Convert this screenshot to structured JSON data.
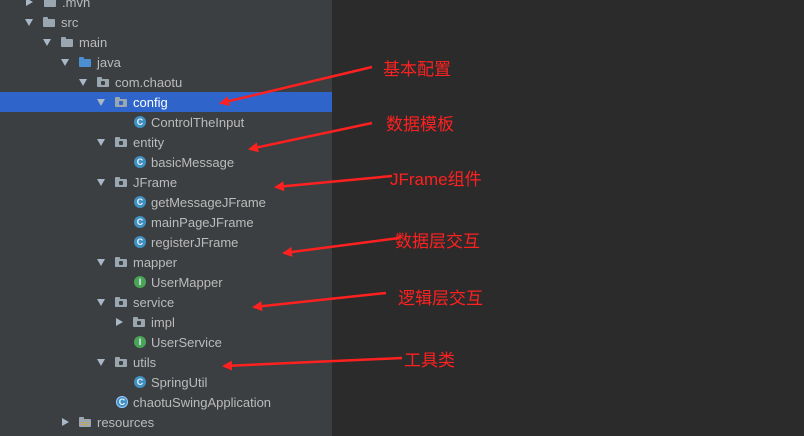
{
  "tree": {
    "rows": [
      {
        "label": ".mvn",
        "icon": "folder-icon"
      },
      {
        "label": "src",
        "icon": "folder-icon"
      },
      {
        "label": "main",
        "icon": "folder-icon"
      },
      {
        "label": "java",
        "icon": "source-folder-icon"
      },
      {
        "label": "com.chaotu",
        "icon": "package-icon"
      },
      {
        "label": "config",
        "icon": "package-icon",
        "selected": true
      },
      {
        "label": "ControlTheInput",
        "icon": "class-icon",
        "glyph": "C"
      },
      {
        "label": "entity",
        "icon": "package-icon"
      },
      {
        "label": "basicMessage",
        "icon": "class-icon",
        "glyph": "C"
      },
      {
        "label": "JFrame",
        "icon": "package-icon"
      },
      {
        "label": "getMessageJFrame",
        "icon": "class-icon",
        "glyph": "C"
      },
      {
        "label": "mainPageJFrame",
        "icon": "class-icon",
        "glyph": "C"
      },
      {
        "label": "registerJFrame",
        "icon": "class-icon",
        "glyph": "C"
      },
      {
        "label": "mapper",
        "icon": "package-icon"
      },
      {
        "label": "UserMapper",
        "icon": "interface-icon",
        "glyph": "I"
      },
      {
        "label": "service",
        "icon": "package-icon"
      },
      {
        "label": "impl",
        "icon": "package-icon"
      },
      {
        "label": "UserService",
        "icon": "interface-icon",
        "glyph": "I"
      },
      {
        "label": "utils",
        "icon": "package-icon"
      },
      {
        "label": "SpringUtil",
        "icon": "class-icon",
        "glyph": "C"
      },
      {
        "label": "chaotuSwingApplication",
        "icon": "spring-boot-class-icon",
        "glyph": "C"
      },
      {
        "label": "resources",
        "icon": "resources-folder-icon"
      }
    ]
  },
  "annotations": [
    {
      "text": "基本配置"
    },
    {
      "text": "数据模板"
    },
    {
      "text": "JFrame组件"
    },
    {
      "text": "数据层交互"
    },
    {
      "text": "逻辑层交互"
    },
    {
      "text": "工具类"
    }
  ],
  "colors": {
    "panel": "#3c3f41",
    "editor": "#2b2b2b",
    "selection": "#2f65ca",
    "annotation": "#ff2020",
    "class_icon": "#3f8fc1",
    "interface_icon": "#4aa457"
  }
}
